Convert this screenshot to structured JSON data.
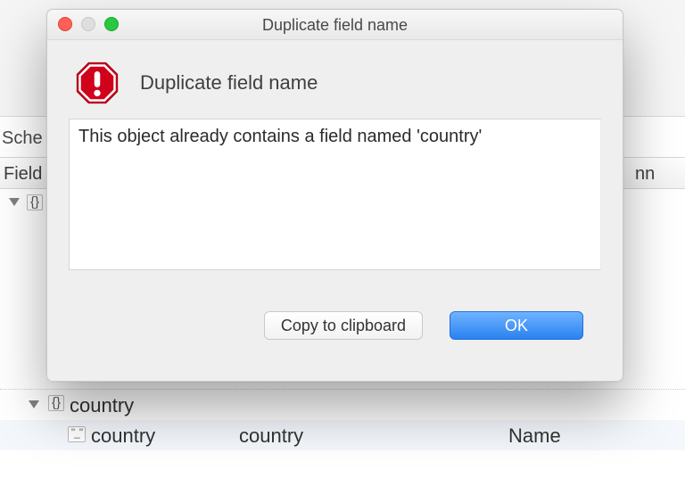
{
  "background": {
    "schema_label": "Sche",
    "header_field": "Field",
    "header_nn": "nn",
    "bottom": {
      "row1_label": "country",
      "row2_icon": "quote-icon",
      "row2_col1": "country",
      "row2_col2": "country",
      "row2_col3": "Name"
    }
  },
  "dialog": {
    "title": "Duplicate field name",
    "heading": "Duplicate field name",
    "message": "This object already contains a field named 'country'",
    "buttons": {
      "copy": "Copy to clipboard",
      "ok": "OK"
    }
  }
}
